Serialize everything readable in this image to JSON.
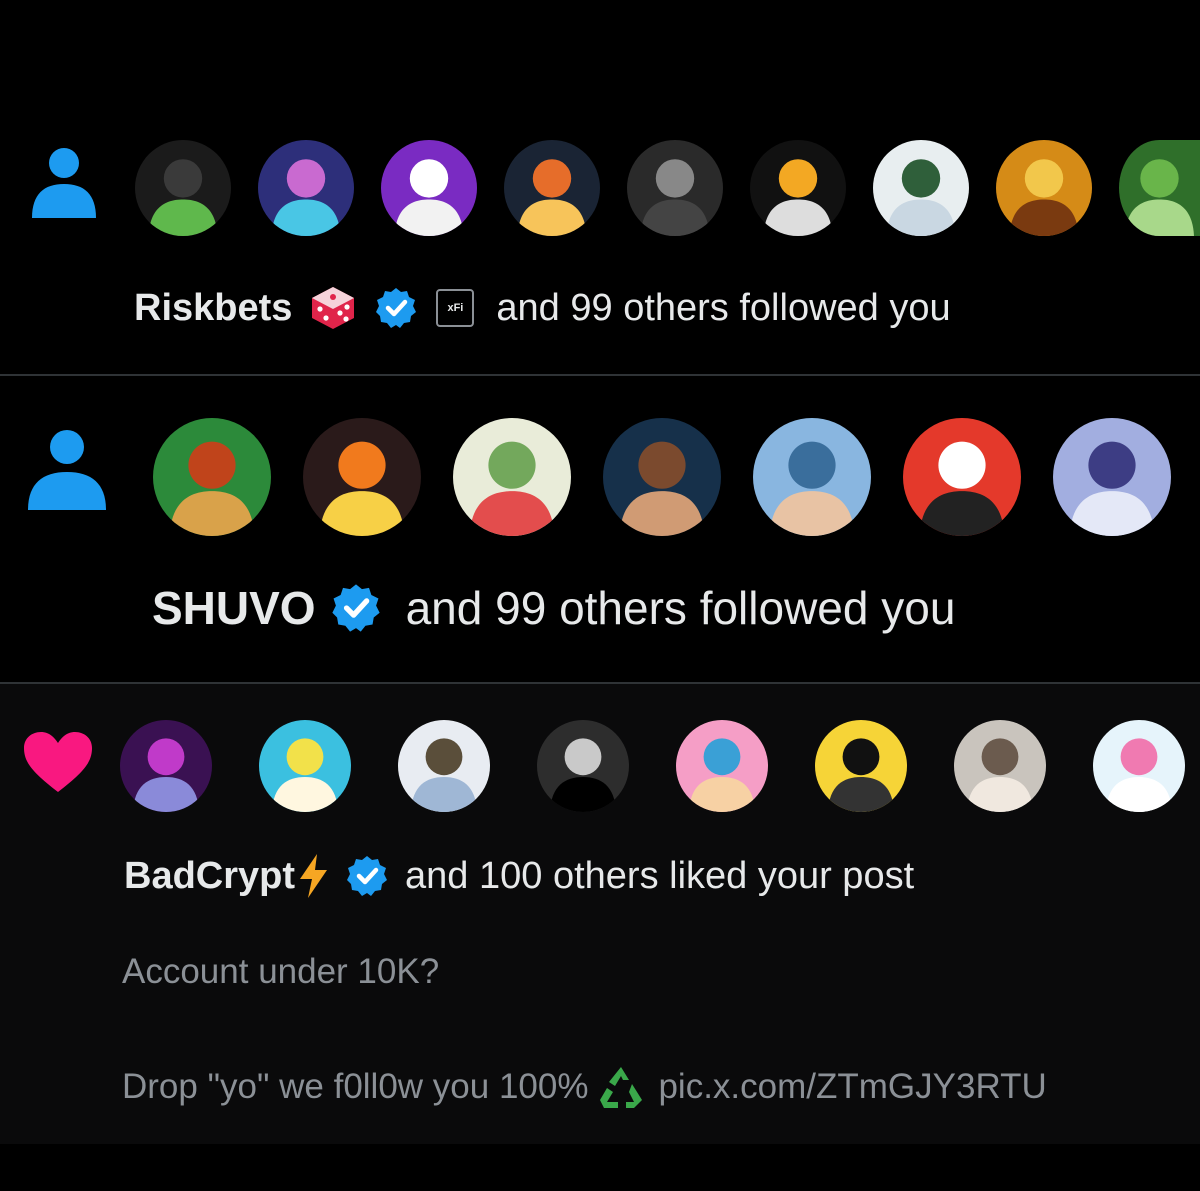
{
  "notifications": [
    {
      "type_icon": "person-icon",
      "user_name": "Riskbets",
      "emoji_icon": "dice-icon",
      "verified_icon": "verified-badge-icon",
      "affiliate_label": "xFi",
      "text": "and 99 others followed you",
      "avatars": [
        "avatar-hooded-figure",
        "avatar-masked-woman",
        "avatar-purple-cap-character",
        "avatar-rocket-launch",
        "avatar-dark-batman",
        "avatar-bitcoin-suit",
        "avatar-man-standing",
        "avatar-anime-blonde",
        "avatar-green-leaf"
      ]
    },
    {
      "type_icon": "person-icon",
      "user_name": "SHUVO",
      "verified_icon": "verified-badge-icon",
      "text": "and 99 others followed you",
      "avatars": [
        "avatar-cowboy-robot",
        "avatar-fire-woman",
        "avatar-mask-bear",
        "avatar-man-portrait",
        "avatar-explorer-hat",
        "avatar-pirate-cat",
        "avatar-blue-abstract"
      ]
    },
    {
      "type_icon": "heart-icon",
      "user_name": "BadCrypt",
      "emoji_icon": "lightning-icon",
      "verified_icon": "verified-badge-icon",
      "text": "and 100 others liked your post",
      "post_line_1": "Account under 10K?",
      "post_line_2": "Drop \"yo\" we f0ll0w you 100%",
      "recycle_icon": "recycle-icon",
      "post_link": "pic.x.com/ZTmGJY3RTU",
      "avatars": [
        "avatar-purple-cyborg",
        "avatar-bunny-bandage",
        "avatar-white-hair-anime",
        "avatar-sunglasses-cat",
        "avatar-cartoon-boy",
        "avatar-pixel-punk",
        "avatar-woman-photo",
        "avatar-pink-bunny",
        "avatar-woman-portrait",
        "avatar-blue-hair-sunglasses"
      ]
    }
  ],
  "colors": {
    "follow_icon": "#1d9bf0",
    "like_icon": "#f91880",
    "verified": "#1d9bf0",
    "secondary_text": "#8b9096"
  }
}
